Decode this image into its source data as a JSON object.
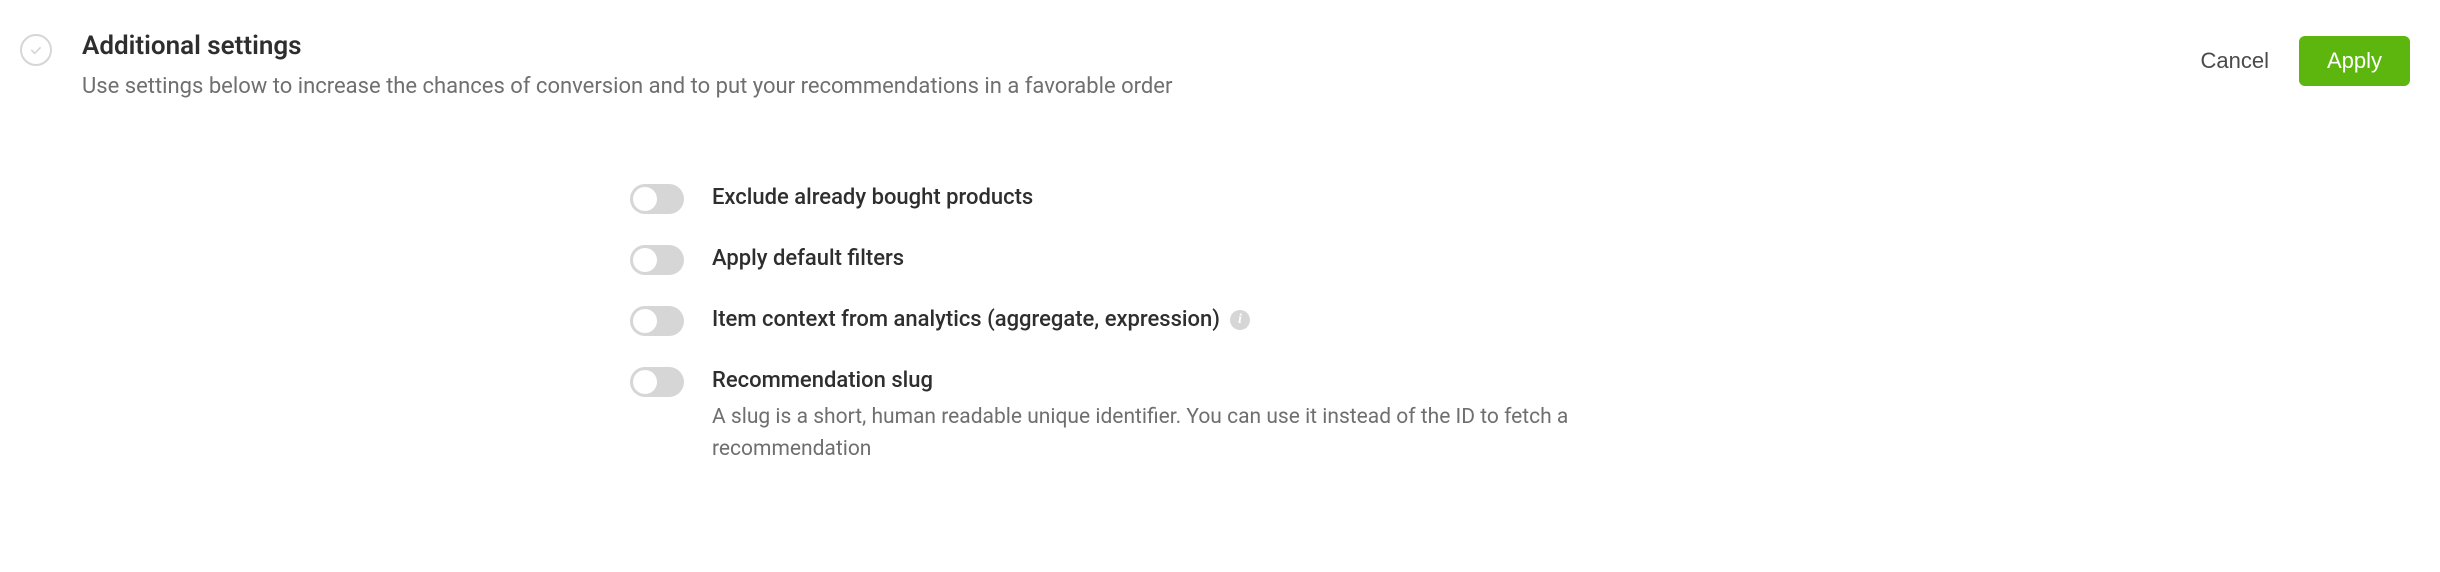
{
  "header": {
    "title": "Additional settings",
    "subtitle": "Use settings below to increase the chances of conversion and to put your recommendations in a favorable order",
    "cancel_label": "Cancel",
    "apply_label": "Apply"
  },
  "settings": [
    {
      "label": "Exclude already bought products",
      "on": false
    },
    {
      "label": "Apply default filters",
      "on": false
    },
    {
      "label": "Item context from analytics (aggregate, expression)",
      "on": false,
      "has_info": true
    },
    {
      "label": "Recommendation slug",
      "on": false,
      "description": "A slug is a short, human readable unique identifier. You can use it instead of the ID to fetch a recommendation"
    }
  ]
}
